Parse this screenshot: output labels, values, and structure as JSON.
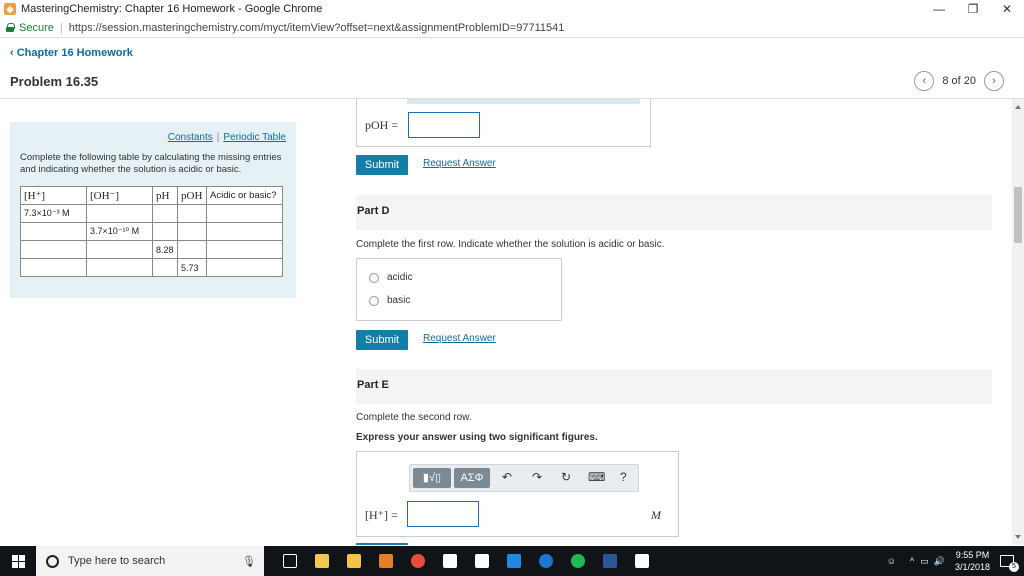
{
  "window": {
    "title": "MasteringChemistry: Chapter 16 Homework - Google Chrome",
    "controls": [
      "—",
      "❐",
      "✕"
    ]
  },
  "address": {
    "secure_label": "Secure",
    "url": "https://session.masteringchemistry.com/myct/itemView?offset=next&assignmentProblemID=97711541"
  },
  "header": {
    "back_label": "Chapter 16 Homework",
    "problem_title": "Problem 16.35",
    "page_count": "8 of 20"
  },
  "sidebar": {
    "link_constants": "Constants",
    "link_separator": "|",
    "link_periodic": "Periodic Table",
    "instruction": "Complete the following table by calculating the missing entries and indicating whether the solution is acidic or basic.",
    "table": {
      "headers": [
        "[H⁺]",
        "[OH⁻]",
        "pH",
        "pOH",
        "Acidic or basic?"
      ],
      "rows": [
        [
          "7.3×10⁻³ M",
          "",
          "",
          "",
          ""
        ],
        [
          "",
          "3.7×10⁻¹⁰ M",
          "",
          "",
          ""
        ],
        [
          "",
          "",
          "8.28",
          "",
          ""
        ],
        [
          "",
          "",
          "",
          "5.73",
          ""
        ]
      ]
    }
  },
  "partC_tail": {
    "poh_label": "pOH =",
    "submit_label": "Submit",
    "request_label": "Request Answer"
  },
  "partD": {
    "title": "Part D",
    "instruction": "Complete the first row. Indicate whether the solution is acidic or basic.",
    "options": [
      "acidic",
      "basic"
    ],
    "submit_label": "Submit",
    "request_label": "Request Answer"
  },
  "partE": {
    "title": "Part E",
    "instruction": "Complete the second row.",
    "express": "Express your answer using two significant figures.",
    "tool_templates": "▮√▯",
    "tool_greek": "ΑΣΦ",
    "tool_undo": "↶",
    "tool_redo": "↷",
    "tool_reset": "↻",
    "tool_keyboard": "⌨",
    "tool_help": "?",
    "h_label": "[H⁺] =",
    "unit": "M"
  },
  "taskbar": {
    "search_placeholder": "Type here to search",
    "time": "9:55 PM",
    "date": "3/1/2018",
    "notif_count": "5"
  },
  "colors": {
    "accent": "#137ea7",
    "link": "#0b6e9c",
    "panel": "#e6f1f6"
  }
}
